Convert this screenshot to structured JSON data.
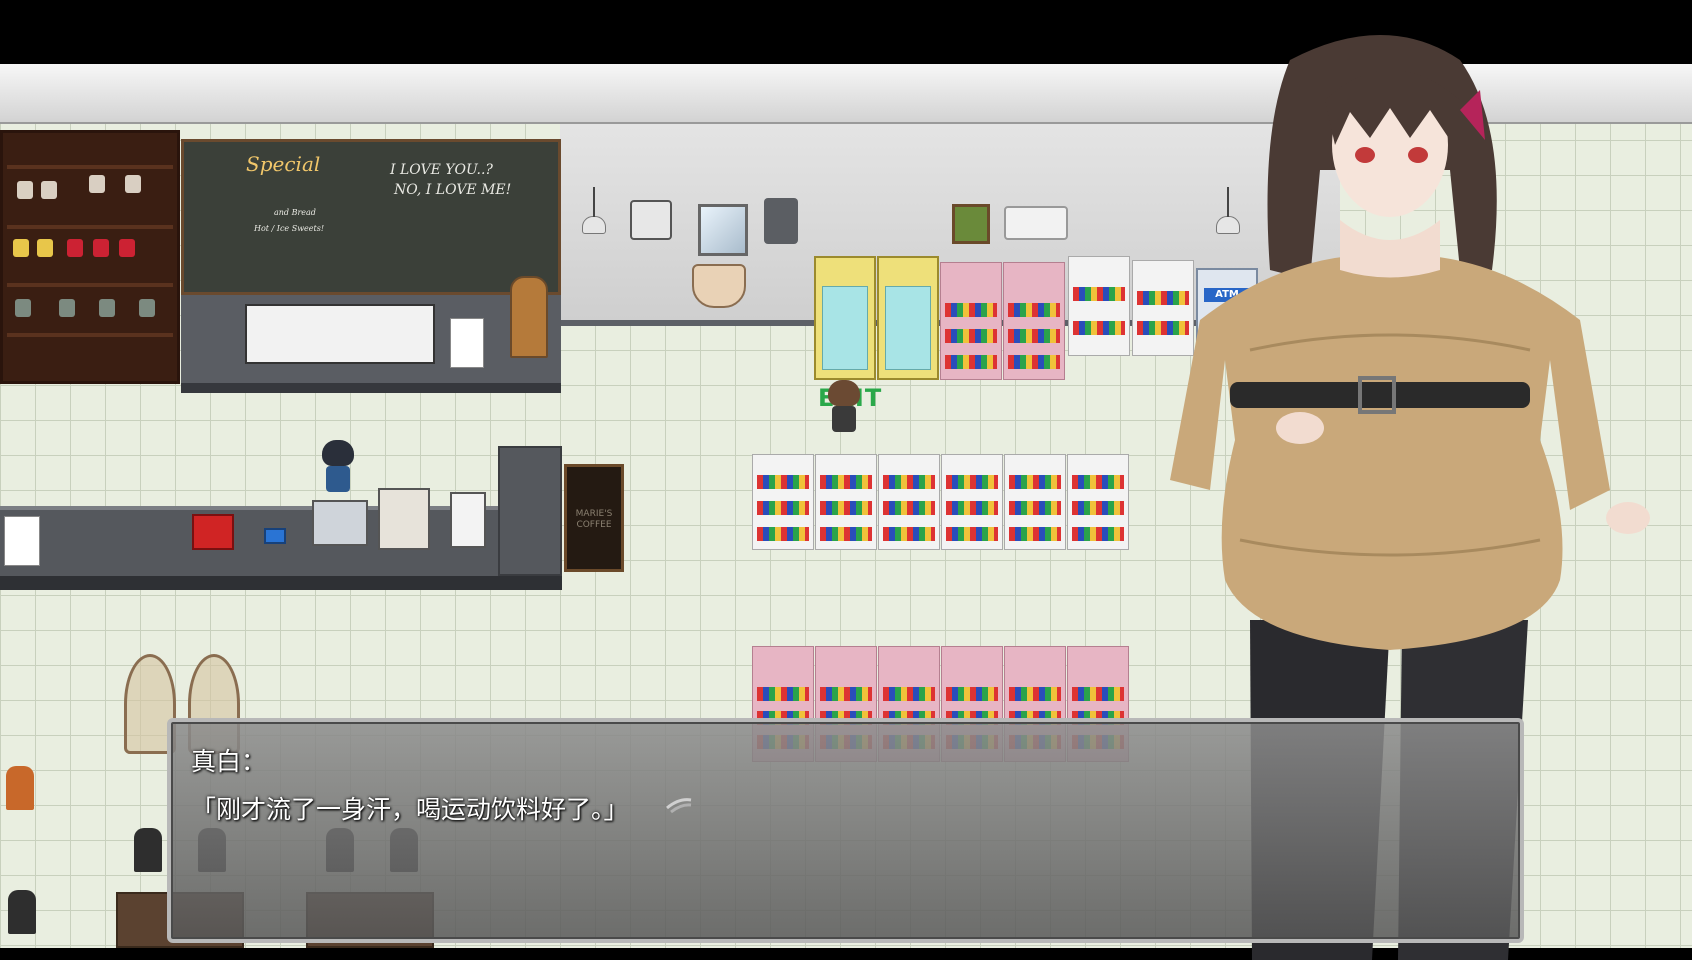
{
  "scene": {
    "chalkboard": {
      "special": "Special",
      "slogan_line1": "I LOVE YOU..?",
      "slogan_line2": "NO, I LOVE ME!",
      "sub_left": "and Bread",
      "sub_left2": "Hot / Ice Sweets!"
    },
    "sign_board_text": "MARIE'S COFFEE",
    "exit_sign_text": "EXIT",
    "atm_text": "ATM"
  },
  "dialog": {
    "speaker": "真白：",
    "line": "「刚才流了一身汗，喝运动饮料好了。」",
    "continue_icon": "waiting-arrow-icon"
  },
  "colors": {
    "floor": "#e9eee0",
    "dialog_border": "#b8b8b8",
    "text": "#ffffff",
    "sweater": "#c9a87a",
    "hair": "#4a3a34"
  }
}
